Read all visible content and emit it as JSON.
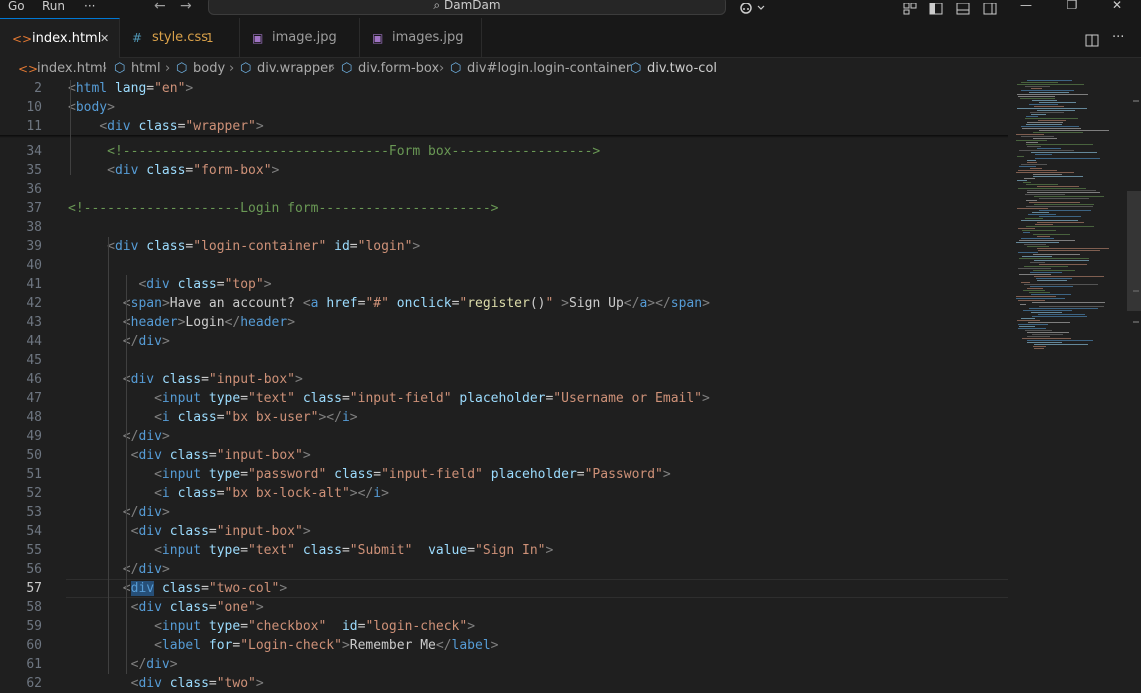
{
  "titlebar": {
    "menu": [
      "Go",
      "Run",
      "···"
    ],
    "back_arrow": "←",
    "forward_arrow": "→",
    "search_icon": "⌕",
    "search_text": "DamDam",
    "copilot_icon": "copilot-icon",
    "window_minimize": "—",
    "window_restore": "❐",
    "window_close": "✕"
  },
  "tabs": [
    {
      "icon": "<>",
      "label": "index.html",
      "active": true,
      "close": "✕",
      "icon_color": "#e37933"
    },
    {
      "icon": "#",
      "label": "style.css",
      "badge": "1",
      "active": false,
      "icon_color": "#519aba",
      "label_color": "#d9a14a"
    },
    {
      "icon": "▣",
      "label": "image.jpg",
      "active": false,
      "icon_color": "#a074c4"
    },
    {
      "icon": "▣",
      "label": "images.jpg",
      "active": false,
      "icon_color": "#a074c4"
    }
  ],
  "breadcrumb": [
    "index.html",
    "html",
    "body",
    "div.wrapper",
    "div.form-box",
    "div#login.login-container",
    "div.two-col"
  ],
  "editor": {
    "sticky_lines": [
      {
        "num": "2",
        "tokens": [
          [
            "br",
            "<"
          ],
          [
            "tag",
            "html"
          ],
          [
            "txt",
            " "
          ],
          [
            "attr",
            "lang"
          ],
          [
            "txt",
            "="
          ],
          [
            "str",
            "\"en\""
          ],
          [
            "br",
            ">"
          ]
        ]
      },
      {
        "num": "10",
        "tokens": [
          [
            "br",
            "<"
          ],
          [
            "tag",
            "body"
          ],
          [
            "br",
            ">"
          ]
        ]
      },
      {
        "num": "11",
        "tokens": [
          [
            "txt",
            "    "
          ],
          [
            "br",
            "<"
          ],
          [
            "tag",
            "div"
          ],
          [
            "txt",
            " "
          ],
          [
            "attr",
            "class"
          ],
          [
            "txt",
            "="
          ],
          [
            "str",
            "\"wrapper\""
          ],
          [
            "br",
            ">"
          ]
        ]
      }
    ],
    "lines": [
      {
        "num": "34",
        "tokens": [
          [
            "txt",
            "     "
          ],
          [
            "com",
            "<!----------------------------------Form box------------------>"
          ]
        ]
      },
      {
        "num": "35",
        "tokens": [
          [
            "txt",
            "     "
          ],
          [
            "br",
            "<"
          ],
          [
            "tag",
            "div"
          ],
          [
            "txt",
            " "
          ],
          [
            "attr",
            "class"
          ],
          [
            "txt",
            "="
          ],
          [
            "str",
            "\"form-box\""
          ],
          [
            "br",
            ">"
          ]
        ]
      },
      {
        "num": "36",
        "tokens": []
      },
      {
        "num": "37",
        "tokens": [
          [
            "com",
            "<!--------------------Login form---------------------->"
          ]
        ]
      },
      {
        "num": "38",
        "tokens": []
      },
      {
        "num": "39",
        "tokens": [
          [
            "txt",
            "     "
          ],
          [
            "br",
            "<"
          ],
          [
            "tag",
            "div"
          ],
          [
            "txt",
            " "
          ],
          [
            "attr",
            "class"
          ],
          [
            "txt",
            "="
          ],
          [
            "str",
            "\"login-container\""
          ],
          [
            "txt",
            " "
          ],
          [
            "attr",
            "id"
          ],
          [
            "txt",
            "="
          ],
          [
            "str",
            "\"login\""
          ],
          [
            "br",
            ">"
          ]
        ]
      },
      {
        "num": "40",
        "tokens": []
      },
      {
        "num": "41",
        "tokens": [
          [
            "txt",
            "         "
          ],
          [
            "br",
            "<"
          ],
          [
            "tag",
            "div"
          ],
          [
            "txt",
            " "
          ],
          [
            "attr",
            "class"
          ],
          [
            "txt",
            "="
          ],
          [
            "str",
            "\"top\""
          ],
          [
            "br",
            ">"
          ]
        ]
      },
      {
        "num": "42",
        "tokens": [
          [
            "txt",
            "       "
          ],
          [
            "br",
            "<"
          ],
          [
            "tag",
            "span"
          ],
          [
            "br",
            ">"
          ],
          [
            "txt",
            "Have an account? "
          ],
          [
            "br",
            "<"
          ],
          [
            "tag",
            "a"
          ],
          [
            "txt",
            " "
          ],
          [
            "attr",
            "href"
          ],
          [
            "txt",
            "="
          ],
          [
            "str",
            "\"#\""
          ],
          [
            "txt",
            " "
          ],
          [
            "attr",
            "onclick"
          ],
          [
            "txt",
            "="
          ],
          [
            "str",
            "\""
          ],
          [
            "fn",
            "register"
          ],
          [
            "txt",
            "()"
          ],
          [
            "str",
            "\""
          ],
          [
            "txt",
            " "
          ],
          [
            "br",
            ">"
          ],
          [
            "txt",
            "Sign Up"
          ],
          [
            "br",
            "</"
          ],
          [
            "tag",
            "a"
          ],
          [
            "br",
            "></"
          ],
          [
            "tag",
            "span"
          ],
          [
            "br",
            ">"
          ]
        ]
      },
      {
        "num": "43",
        "tokens": [
          [
            "txt",
            "       "
          ],
          [
            "br",
            "<"
          ],
          [
            "tag",
            "header"
          ],
          [
            "br",
            ">"
          ],
          [
            "txt",
            "Login"
          ],
          [
            "br",
            "</"
          ],
          [
            "tag",
            "header"
          ],
          [
            "br",
            ">"
          ]
        ]
      },
      {
        "num": "44",
        "tokens": [
          [
            "txt",
            "       "
          ],
          [
            "br",
            "</"
          ],
          [
            "tag",
            "div"
          ],
          [
            "br",
            ">"
          ]
        ]
      },
      {
        "num": "45",
        "tokens": []
      },
      {
        "num": "46",
        "tokens": [
          [
            "txt",
            "       "
          ],
          [
            "br",
            "<"
          ],
          [
            "tag",
            "div"
          ],
          [
            "txt",
            " "
          ],
          [
            "attr",
            "class"
          ],
          [
            "txt",
            "="
          ],
          [
            "str",
            "\"input-box\""
          ],
          [
            "br",
            ">"
          ]
        ]
      },
      {
        "num": "47",
        "tokens": [
          [
            "txt",
            "           "
          ],
          [
            "br",
            "<"
          ],
          [
            "tag",
            "input"
          ],
          [
            "txt",
            " "
          ],
          [
            "attr",
            "type"
          ],
          [
            "txt",
            "="
          ],
          [
            "str",
            "\"text\""
          ],
          [
            "txt",
            " "
          ],
          [
            "attr",
            "class"
          ],
          [
            "txt",
            "="
          ],
          [
            "str",
            "\"input-field\""
          ],
          [
            "txt",
            " "
          ],
          [
            "attr",
            "placeholder"
          ],
          [
            "txt",
            "="
          ],
          [
            "str",
            "\"Username or Email\""
          ],
          [
            "br",
            ">"
          ]
        ]
      },
      {
        "num": "48",
        "tokens": [
          [
            "txt",
            "           "
          ],
          [
            "br",
            "<"
          ],
          [
            "tag",
            "i"
          ],
          [
            "txt",
            " "
          ],
          [
            "attr",
            "class"
          ],
          [
            "txt",
            "="
          ],
          [
            "str",
            "\"bx bx-user\""
          ],
          [
            "br",
            "></"
          ],
          [
            "tag",
            "i"
          ],
          [
            "br",
            ">"
          ]
        ]
      },
      {
        "num": "49",
        "tokens": [
          [
            "txt",
            "       "
          ],
          [
            "br",
            "</"
          ],
          [
            "tag",
            "div"
          ],
          [
            "br",
            ">"
          ]
        ]
      },
      {
        "num": "50",
        "tokens": [
          [
            "txt",
            "        "
          ],
          [
            "br",
            "<"
          ],
          [
            "tag",
            "div"
          ],
          [
            "txt",
            " "
          ],
          [
            "attr",
            "class"
          ],
          [
            "txt",
            "="
          ],
          [
            "str",
            "\"input-box\""
          ],
          [
            "br",
            ">"
          ]
        ]
      },
      {
        "num": "51",
        "tokens": [
          [
            "txt",
            "           "
          ],
          [
            "br",
            "<"
          ],
          [
            "tag",
            "input"
          ],
          [
            "txt",
            " "
          ],
          [
            "attr",
            "type"
          ],
          [
            "txt",
            "="
          ],
          [
            "str",
            "\"password\""
          ],
          [
            "txt",
            " "
          ],
          [
            "attr",
            "class"
          ],
          [
            "txt",
            "="
          ],
          [
            "str",
            "\"input-field\""
          ],
          [
            "txt",
            " "
          ],
          [
            "attr",
            "placeholder"
          ],
          [
            "txt",
            "="
          ],
          [
            "str",
            "\"Password\""
          ],
          [
            "br",
            ">"
          ]
        ]
      },
      {
        "num": "52",
        "tokens": [
          [
            "txt",
            "           "
          ],
          [
            "br",
            "<"
          ],
          [
            "tag",
            "i"
          ],
          [
            "txt",
            " "
          ],
          [
            "attr",
            "class"
          ],
          [
            "txt",
            "="
          ],
          [
            "str",
            "\"bx bx-lock-alt\""
          ],
          [
            "br",
            "></"
          ],
          [
            "tag",
            "i"
          ],
          [
            "br",
            ">"
          ]
        ]
      },
      {
        "num": "53",
        "tokens": [
          [
            "txt",
            "       "
          ],
          [
            "br",
            "</"
          ],
          [
            "tag",
            "div"
          ],
          [
            "br",
            ">"
          ]
        ]
      },
      {
        "num": "54",
        "tokens": [
          [
            "txt",
            "        "
          ],
          [
            "br",
            "<"
          ],
          [
            "tag",
            "div"
          ],
          [
            "txt",
            " "
          ],
          [
            "attr",
            "class"
          ],
          [
            "txt",
            "="
          ],
          [
            "str",
            "\"input-box\""
          ],
          [
            "br",
            ">"
          ]
        ]
      },
      {
        "num": "55",
        "tokens": [
          [
            "txt",
            "           "
          ],
          [
            "br",
            "<"
          ],
          [
            "tag",
            "input"
          ],
          [
            "txt",
            " "
          ],
          [
            "attr",
            "type"
          ],
          [
            "txt",
            "="
          ],
          [
            "str",
            "\"text\""
          ],
          [
            "txt",
            " "
          ],
          [
            "attr",
            "class"
          ],
          [
            "txt",
            "="
          ],
          [
            "str",
            "\"Submit\""
          ],
          [
            "txt",
            "  "
          ],
          [
            "attr",
            "value"
          ],
          [
            "txt",
            "="
          ],
          [
            "str",
            "\"Sign In\""
          ],
          [
            "br",
            ">"
          ]
        ]
      },
      {
        "num": "56",
        "tokens": [
          [
            "txt",
            "       "
          ],
          [
            "br",
            "</"
          ],
          [
            "tag",
            "div"
          ],
          [
            "br",
            ">"
          ]
        ]
      },
      {
        "num": "57",
        "current": true,
        "tokens": [
          [
            "txt",
            "       "
          ],
          [
            "br",
            "<"
          ],
          [
            "sel",
            "div"
          ],
          [
            "txt",
            " "
          ],
          [
            "attr",
            "class"
          ],
          [
            "txt",
            "="
          ],
          [
            "str",
            "\"two-col\""
          ],
          [
            "br",
            ">"
          ]
        ]
      },
      {
        "num": "58",
        "tokens": [
          [
            "txt",
            "        "
          ],
          [
            "br",
            "<"
          ],
          [
            "tag",
            "div"
          ],
          [
            "txt",
            " "
          ],
          [
            "attr",
            "class"
          ],
          [
            "txt",
            "="
          ],
          [
            "str",
            "\"one\""
          ],
          [
            "br",
            ">"
          ]
        ]
      },
      {
        "num": "59",
        "tokens": [
          [
            "txt",
            "           "
          ],
          [
            "br",
            "<"
          ],
          [
            "tag",
            "input"
          ],
          [
            "txt",
            " "
          ],
          [
            "attr",
            "type"
          ],
          [
            "txt",
            "="
          ],
          [
            "str",
            "\"checkbox\""
          ],
          [
            "txt",
            "  "
          ],
          [
            "attr",
            "id"
          ],
          [
            "txt",
            "="
          ],
          [
            "str",
            "\"login-check\""
          ],
          [
            "br",
            ">"
          ]
        ]
      },
      {
        "num": "60",
        "tokens": [
          [
            "txt",
            "           "
          ],
          [
            "br",
            "<"
          ],
          [
            "tag",
            "label"
          ],
          [
            "txt",
            " "
          ],
          [
            "attr",
            "for"
          ],
          [
            "txt",
            "="
          ],
          [
            "str",
            "\"Login-check\""
          ],
          [
            "br",
            ">"
          ],
          [
            "txt",
            "Remember Me"
          ],
          [
            "br",
            "</"
          ],
          [
            "tag",
            "label"
          ],
          [
            "br",
            ">"
          ]
        ]
      },
      {
        "num": "61",
        "tokens": [
          [
            "txt",
            "        "
          ],
          [
            "br",
            "</"
          ],
          [
            "tag",
            "div"
          ],
          [
            "br",
            ">"
          ]
        ]
      },
      {
        "num": "62",
        "tokens": [
          [
            "txt",
            "        "
          ],
          [
            "br",
            "<"
          ],
          [
            "tag",
            "div"
          ],
          [
            "txt",
            " "
          ],
          [
            "attr",
            "class"
          ],
          [
            "txt",
            "="
          ],
          [
            "str",
            "\"two\""
          ],
          [
            "br",
            ">"
          ]
        ]
      }
    ]
  }
}
